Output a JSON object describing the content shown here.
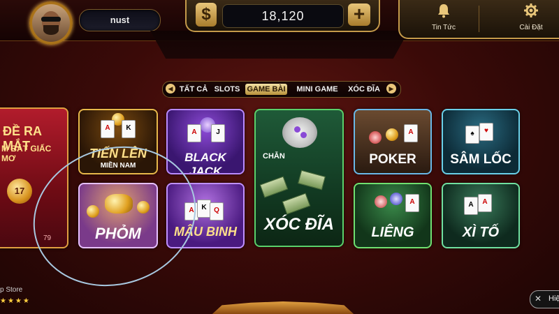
{
  "header": {
    "username": "nust",
    "balance": "18,120",
    "currency_symbol": "$",
    "topup_symbol": "+",
    "news_label": "Tin Tức",
    "settings_label": "Cài Đặt"
  },
  "tabs": {
    "prev_arrow": "◀",
    "next_arrow": "▶",
    "items": [
      {
        "label": "TẤT CẢ"
      },
      {
        "label": "SLOTS"
      },
      {
        "label": "GAME BÀI"
      },
      {
        "label": "MINI GAME"
      },
      {
        "label": "XÓC ĐĨA"
      }
    ],
    "active_index": 2
  },
  "banner": {
    "line1": "ĐỀ RA MẮT",
    "line2": "M BẮT GIẤC MƠ",
    "ball_number": "17",
    "number": "79"
  },
  "games": {
    "tienlen": {
      "title": "TIẾN LÊN",
      "subtitle": "MIỀN NAM"
    },
    "blackjack": {
      "title": "BLACK JACK"
    },
    "xocdia": {
      "title": "XÓC ĐĨA",
      "label_chan": "CHẴN"
    },
    "poker": {
      "title": "POKER"
    },
    "samloc": {
      "title": "SÂM LỐC"
    },
    "phom": {
      "title": "PHỎM"
    },
    "maubinh": {
      "title": "MẬU BINH"
    },
    "lieng": {
      "title": "LIÊNG"
    },
    "xito": {
      "title": "XÌ TỐ"
    }
  },
  "footer": {
    "store_label": "p Store",
    "stars": "★★★★",
    "right_chip_label": "Hiệ"
  },
  "icons": {
    "bell": "bell-icon",
    "gear": "gear-icon",
    "dollar": "dollar-icon",
    "plus": "plus-icon"
  },
  "colors": {
    "accent_gold": "#e9c67a",
    "background": "#3a0a08",
    "lasso": "#a8c8e0"
  }
}
